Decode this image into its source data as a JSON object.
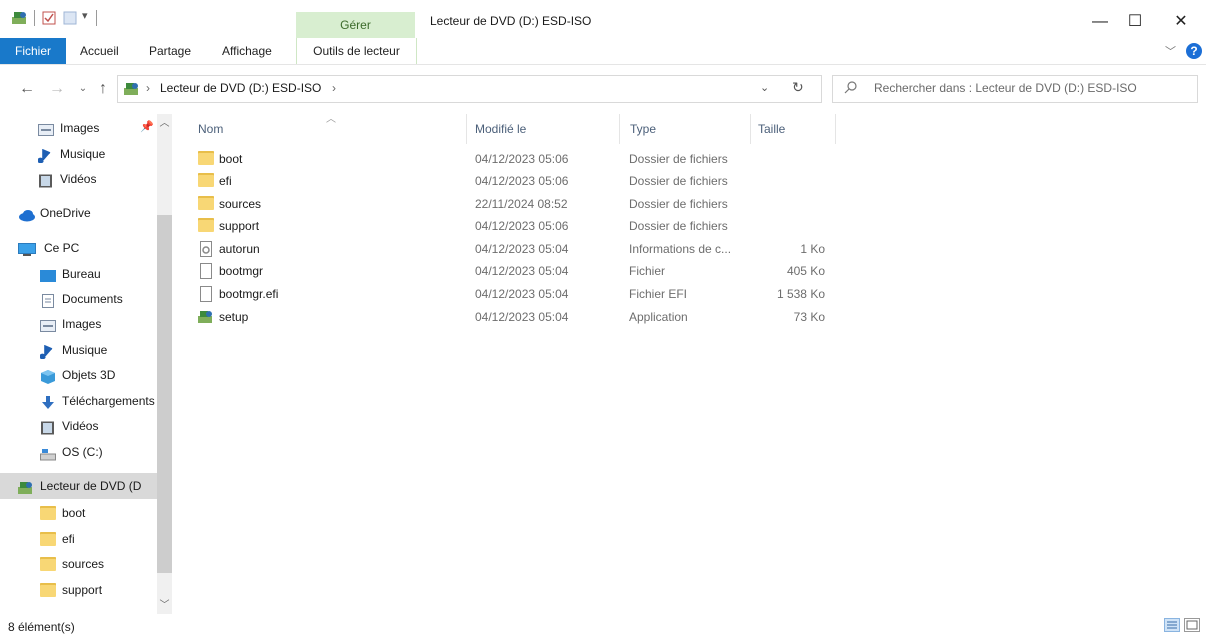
{
  "window": {
    "title": "Lecteur de DVD (D:) ESD-ISO",
    "contextual_group": "Gérer",
    "controls": {
      "minimize": "—",
      "maximize": "☐",
      "close": "✕"
    }
  },
  "ribbon": {
    "tabs": [
      "Fichier",
      "Accueil",
      "Partage",
      "Affichage",
      "Outils de lecteur"
    ]
  },
  "address": {
    "path": "Lecteur de DVD (D:) ESD-ISO",
    "search_placeholder": "Rechercher dans : Lecteur de DVD (D:) ESD-ISO"
  },
  "nav": {
    "quick_access": [
      {
        "label": "Images",
        "icon": "images-icon"
      },
      {
        "label": "Musique",
        "icon": "music-icon"
      },
      {
        "label": "Vidéos",
        "icon": "videos-icon"
      }
    ],
    "onedrive": "OneDrive",
    "this_pc": "Ce PC",
    "pc_items": [
      {
        "label": "Bureau",
        "icon": "desktop-icon"
      },
      {
        "label": "Documents",
        "icon": "documents-icon"
      },
      {
        "label": "Images",
        "icon": "images-icon"
      },
      {
        "label": "Musique",
        "icon": "music-icon"
      },
      {
        "label": "Objets 3D",
        "icon": "3d-objects-icon"
      },
      {
        "label": "Téléchargements",
        "icon": "downloads-icon"
      },
      {
        "label": "Vidéos",
        "icon": "videos-icon"
      },
      {
        "label": "OS (C:)",
        "icon": "drive-icon"
      }
    ],
    "dvd": "Lecteur de DVD (D",
    "dvd_children": [
      "boot",
      "efi",
      "sources",
      "support"
    ]
  },
  "columns": {
    "name": "Nom",
    "modified": "Modifié le",
    "type": "Type",
    "size": "Taille"
  },
  "files": [
    {
      "name": "boot",
      "modified": "04/12/2023 05:06",
      "type": "Dossier de fichiers",
      "size": "",
      "icon": "folder-icon"
    },
    {
      "name": "efi",
      "modified": "04/12/2023 05:06",
      "type": "Dossier de fichiers",
      "size": "",
      "icon": "folder-icon"
    },
    {
      "name": "sources",
      "modified": "22/11/2024 08:52",
      "type": "Dossier de fichiers",
      "size": "",
      "icon": "folder-icon"
    },
    {
      "name": "support",
      "modified": "04/12/2023 05:06",
      "type": "Dossier de fichiers",
      "size": "",
      "icon": "folder-icon"
    },
    {
      "name": "autorun",
      "modified": "04/12/2023 05:04",
      "type": "Informations de c...",
      "size": "1 Ko",
      "icon": "settings-file-icon"
    },
    {
      "name": "bootmgr",
      "modified": "04/12/2023 05:04",
      "type": "Fichier",
      "size": "405 Ko",
      "icon": "file-icon"
    },
    {
      "name": "bootmgr.efi",
      "modified": "04/12/2023 05:04",
      "type": "Fichier EFI",
      "size": "1 538 Ko",
      "icon": "file-icon"
    },
    {
      "name": "setup",
      "modified": "04/12/2023 05:04",
      "type": "Application",
      "size": "73 Ko",
      "icon": "setup-app-icon"
    }
  ],
  "status": {
    "count": "8 élément(s)"
  }
}
